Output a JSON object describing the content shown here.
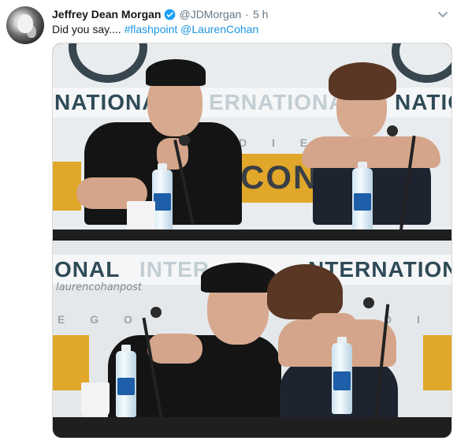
{
  "tweet": {
    "author_name": "Jeffrey Dean Morgan",
    "handle": "@JDMorgan",
    "separator": "·",
    "time": "5 h",
    "text_prefix": "Did you say.... ",
    "hashtag": "#flashpoint",
    "mention": "@LaurenCohan"
  },
  "media": {
    "top_banner_left": "NATIONAL",
    "top_banner_mid": "ERNATIONAL",
    "top_banner_right": "NATIO",
    "top_diego": "D I E G O",
    "top_con": "CON",
    "bottom_banner_left": "ONAL",
    "bottom_banner_mid": "INTER",
    "bottom_banner_right": "NTERNATION",
    "bottom_diego_left": "E G O",
    "bottom_diego_right": "D I E",
    "watermark": "laurencohanpost"
  },
  "colors": {
    "link": "#1b95e0",
    "name": "#14171a",
    "muted": "#657786",
    "verified": "#1da1f2"
  },
  "icons": {
    "verified": "verified-badge-icon",
    "caret": "chevron-down-icon"
  }
}
